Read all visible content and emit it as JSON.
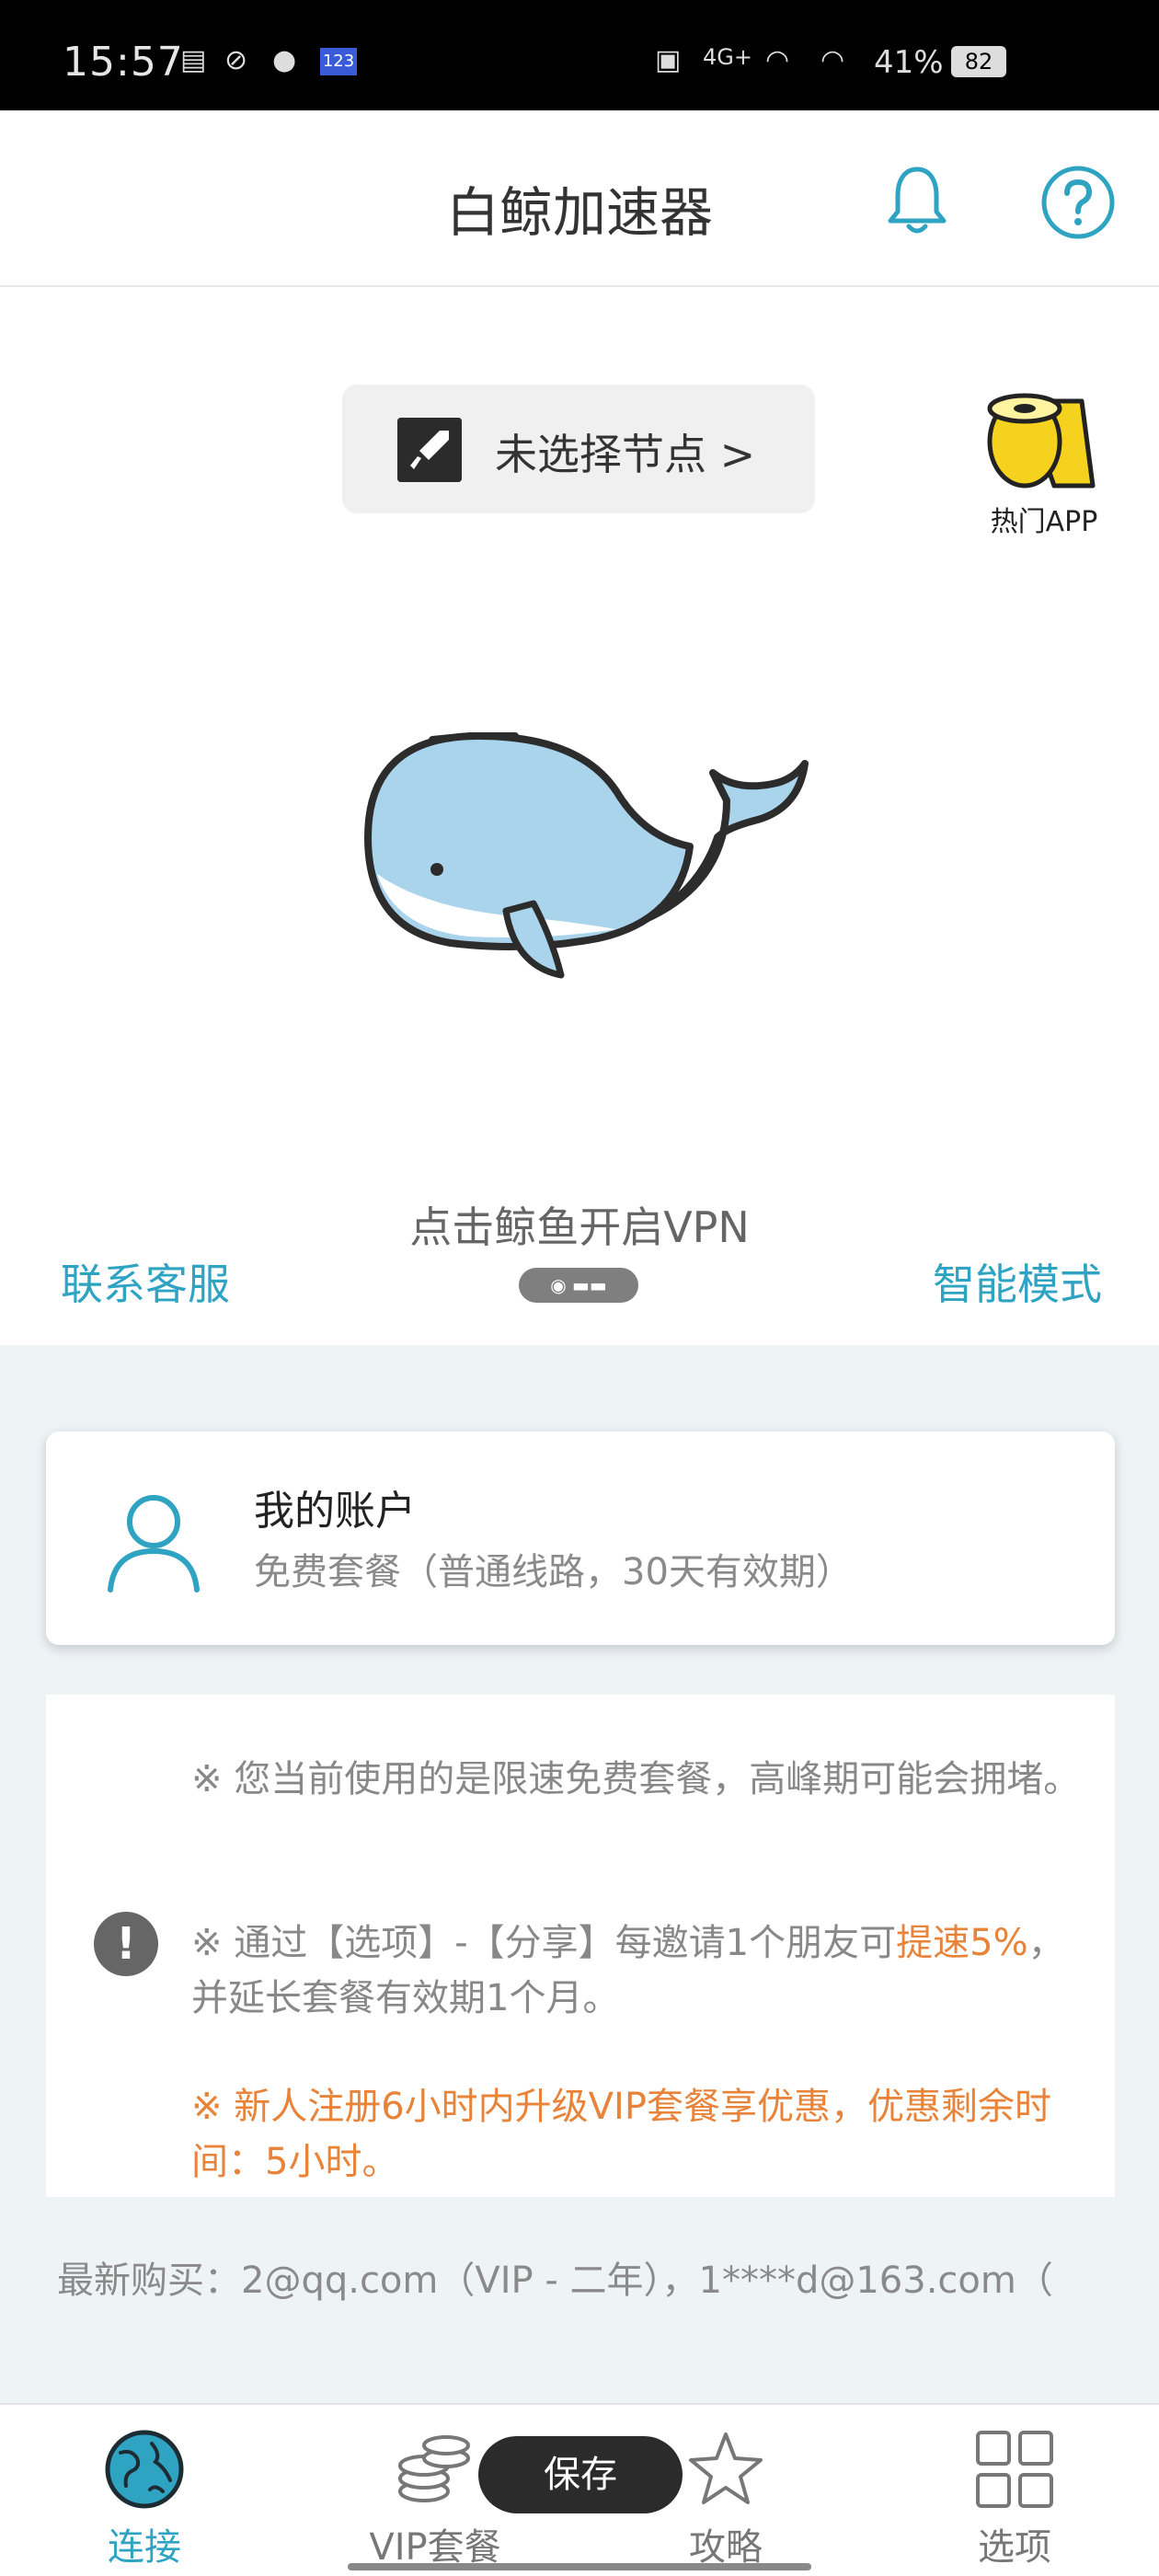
{
  "status_bar": {
    "time": "15:57",
    "network": "4G+",
    "battery_percent": "41%",
    "battery_level": "82"
  },
  "header": {
    "title": "白鲸加速器",
    "bell_icon": "bell-icon",
    "help_icon": "help-icon"
  },
  "node_selector": {
    "label": "未选择节点 >"
  },
  "hot_app": {
    "label": "热门APP"
  },
  "vpn_hint": "点击鲸鱼开启VPN",
  "contact_label": "联系客服",
  "smart_mode_label": "智能模式",
  "account": {
    "title": "我的账户",
    "plan": "免费套餐（普通线路，30天有效期）"
  },
  "notice": {
    "line1": "※ 您当前使用的是限速免费套餐，高峰期可能会拥堵。",
    "line2_part1": "※ 通过【选项】-【分享】每邀请1个朋友可",
    "line2_highlight": "提速5%",
    "line2_part2": "，并延长套餐有效期1个月。",
    "line3": "※ 新人注册6小时内升级VIP套餐享优惠，优惠剩余时间：5小时。"
  },
  "latest_purchase": "最新购买：2@qq.com（VIP - 二年），1****d@163.com（",
  "toast": "保存",
  "bottom_nav": [
    {
      "label": "连接",
      "icon": "globe-icon",
      "active": true
    },
    {
      "label": "VIP套餐",
      "icon": "coins-icon",
      "active": false
    },
    {
      "label": "攻略",
      "icon": "star-icon",
      "active": false
    },
    {
      "label": "选项",
      "icon": "grid-icon",
      "active": false
    }
  ],
  "colors": {
    "accent": "#2fa3c2",
    "highlight": "#e8833a",
    "whale_body": "#a9d4ec"
  }
}
